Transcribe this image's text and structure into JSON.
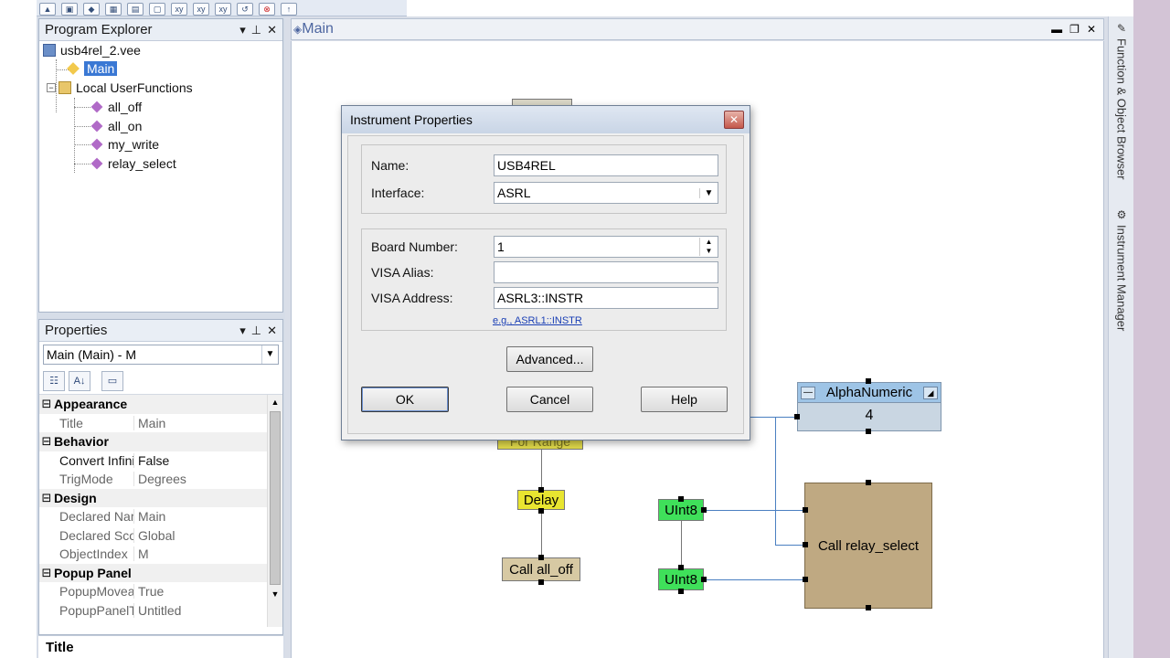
{
  "program_explorer": {
    "title": "Program Explorer",
    "root": "usb4rel_2.vee",
    "main": "Main",
    "folder": "Local UserFunctions",
    "functions": [
      "all_off",
      "all_on",
      "my_write",
      "relay_select"
    ]
  },
  "properties": {
    "title": "Properties",
    "selected": "Main (Main) - M",
    "categories": [
      {
        "name": "Appearance",
        "rows": [
          {
            "k": "Title",
            "v": "Main"
          }
        ]
      },
      {
        "name": "Behavior",
        "rows": [
          {
            "k": "Convert Infinity t",
            "v": "False"
          },
          {
            "k": "TrigMode",
            "v": "Degrees"
          }
        ]
      },
      {
        "name": "Design",
        "rows": [
          {
            "k": "Declared Name",
            "v": "Main"
          },
          {
            "k": "Declared Scope",
            "v": "Global"
          },
          {
            "k": "ObjectIndex",
            "v": "M"
          }
        ]
      },
      {
        "name": "Popup Panel",
        "rows": [
          {
            "k": "PopupMoveable",
            "v": "True"
          },
          {
            "k": "PopupPanelTitle",
            "v": "Untitled"
          }
        ]
      }
    ],
    "description_title": "Title"
  },
  "main_window": {
    "title": "Main"
  },
  "right_sidebar": {
    "tab1": "Function & Object Browser",
    "tab2": "Instrument Manager"
  },
  "canvas": {
    "delay": "Delay",
    "call_all_off": "Call all_off",
    "hidden_label": "For Range",
    "uint8_a": "UInt8",
    "uint8_b": "UInt8",
    "alpha_title": "AlphaNumeric",
    "alpha_value": "4",
    "call_relay": "Call relay_select"
  },
  "dialog": {
    "title": "Instrument Properties",
    "name_label": "Name:",
    "name_value": "USB4REL",
    "interface_label": "Interface:",
    "interface_value": "ASRL",
    "board_label": "Board Number:",
    "board_value": "1",
    "alias_label": "VISA Alias:",
    "alias_value": "",
    "address_label": "VISA Address:",
    "address_value": "ASRL3::INSTR",
    "example_link": "e.g., ASRL1::INSTR",
    "advanced": "Advanced...",
    "ok": "OK",
    "cancel": "Cancel",
    "help": "Help"
  }
}
